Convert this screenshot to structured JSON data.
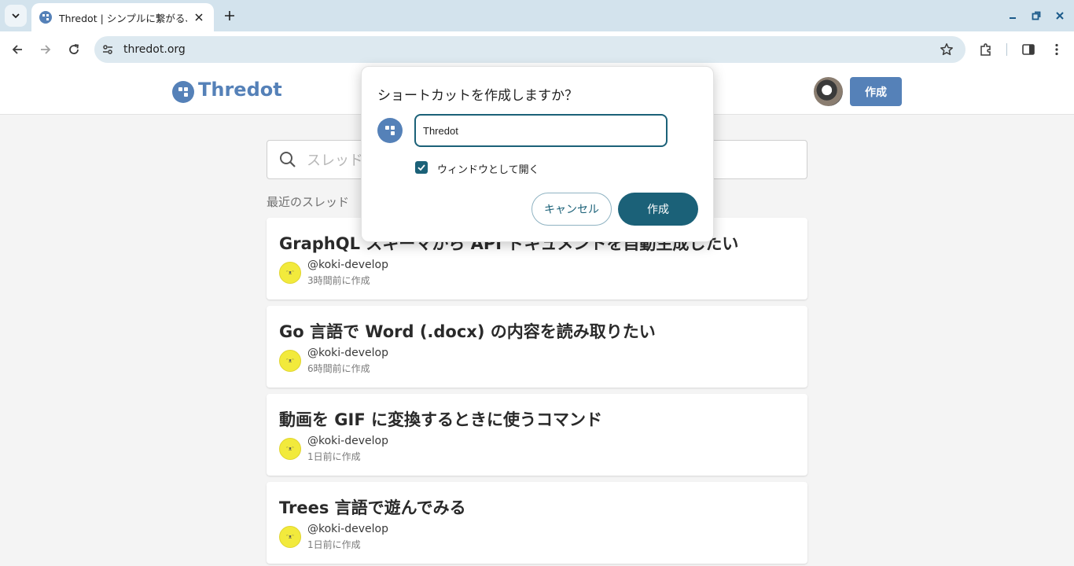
{
  "browser": {
    "tab_title": "Thredot | シンプルに繋がる、",
    "url": "thredot.org"
  },
  "header": {
    "logo_text": "Thredot",
    "create_label": "作成"
  },
  "search": {
    "placeholder": "スレッド"
  },
  "recent": {
    "label": "最近のスレッド",
    "threads": [
      {
        "title": "GraphQL スキーマから API ドキュメントを自動生成したい",
        "user": "@koki-develop",
        "time": "3時間前に作成"
      },
      {
        "title": "Go 言語で Word (.docx) の内容を読み取りたい",
        "user": "@koki-develop",
        "time": "6時間前に作成"
      },
      {
        "title": "動画を GIF に変換するときに使うコマンド",
        "user": "@koki-develop",
        "time": "1日前に作成"
      },
      {
        "title": "Trees 言語で遊んでみる",
        "user": "@koki-develop",
        "time": "1日前に作成"
      }
    ]
  },
  "dialog": {
    "title": "ショートカットを作成しますか？",
    "name_value": "Thredot",
    "open_as_window_label": "ウィンドウとして開く",
    "open_as_window_checked": true,
    "cancel_label": "キャンセル",
    "create_label": "作成"
  },
  "colors": {
    "brand": "#5581b8",
    "dialog_accent": "#1b6178"
  }
}
